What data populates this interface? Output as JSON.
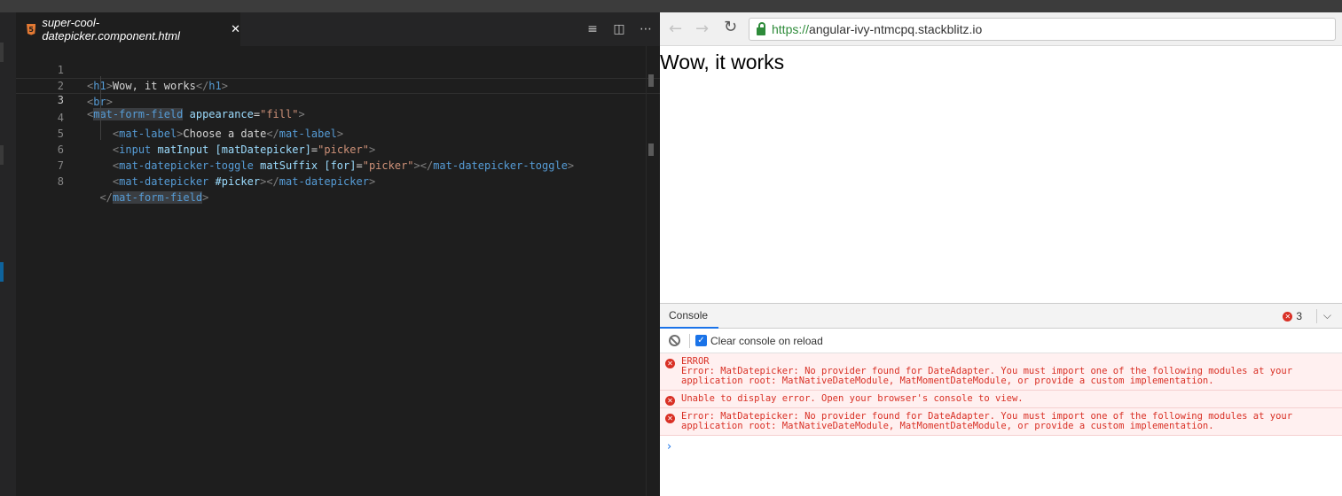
{
  "editor": {
    "tab": {
      "icon": "html5-icon",
      "icon_glyph": "5",
      "filename": "super-cool-datepicker.component.html",
      "close": "✕"
    },
    "actions": {
      "outline": "≡",
      "split": "◫",
      "more": "⋯"
    },
    "lines": [
      {
        "n": "1"
      },
      {
        "n": "2"
      },
      {
        "n": "3"
      },
      {
        "n": "4"
      },
      {
        "n": "5"
      },
      {
        "n": "6"
      },
      {
        "n": "7"
      },
      {
        "n": "8"
      }
    ],
    "code": {
      "h1_tag": "h1",
      "h1_text": "Wow, it works",
      "br_tag": "br",
      "form_field_tag": "mat-form-field",
      "appearance_attr": "appearance",
      "appearance_val": "\"fill\"",
      "label_tag": "mat-label",
      "label_text": "Choose a date",
      "input_tag": "input",
      "input_attr1": "matInput",
      "input_attr2": "[matDatepicker]",
      "input_val": "\"picker\"",
      "toggle_tag": "mat-datepicker-toggle",
      "toggle_attr1": "matSuffix",
      "toggle_attr2": "[for]",
      "toggle_val": "\"picker\"",
      "picker_tag": "mat-datepicker",
      "picker_ref": "#picker"
    }
  },
  "browser": {
    "back": "←",
    "forward": "→",
    "reload": "↻",
    "url_scheme": "https://",
    "url_host": "angular-ivy-ntmcpq.stackblitz.io",
    "heading": "Wow, it works"
  },
  "devtools": {
    "tab_console": "Console",
    "error_count": "3",
    "chevron": "⌵",
    "clear_label": "Clear console on reload",
    "messages": [
      {
        "text": "ERROR\nError: MatDatepicker: No provider found for DateAdapter. You must import one of the following modules at your\napplication root: MatNativeDateModule, MatMomentDateModule, or provide a custom implementation."
      },
      {
        "text": "Unable to display error. Open your browser's console to view."
      },
      {
        "text": "Error: MatDatepicker: No provider found for DateAdapter. You must import one of the following modules at your\napplication root: MatNativeDateModule, MatMomentDateModule, or provide a custom implementation."
      }
    ],
    "prompt": "›"
  }
}
